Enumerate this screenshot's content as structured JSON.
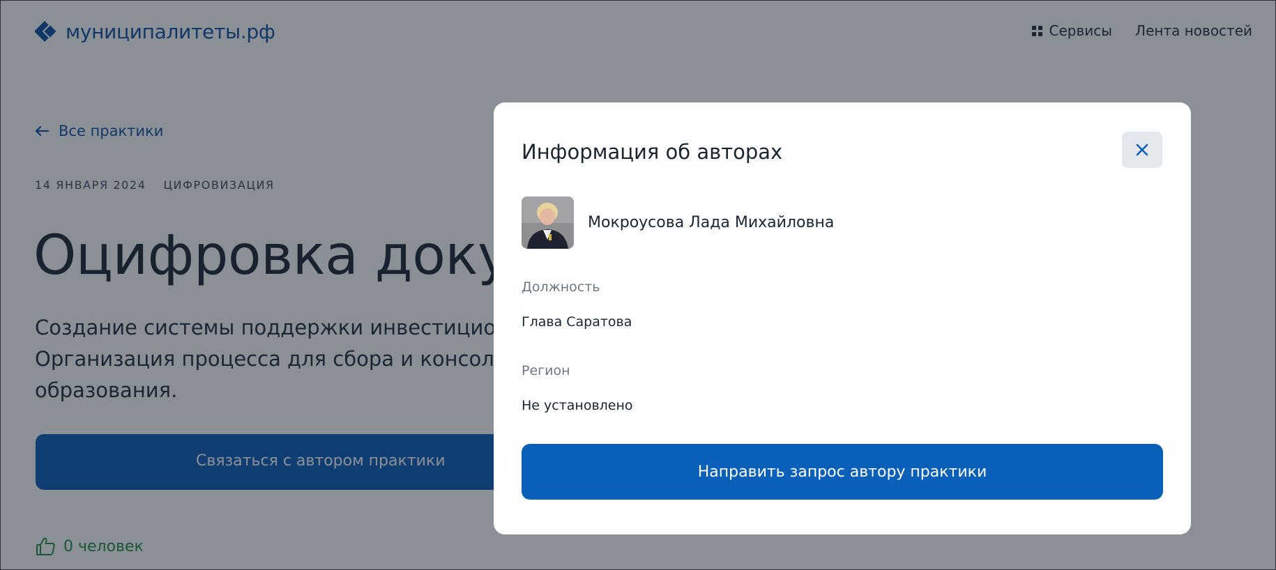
{
  "header": {
    "logo_text": "муниципалитеты.рф",
    "nav": {
      "services": "Сервисы",
      "news": "Лента новостей"
    }
  },
  "article": {
    "back_link": "Все практики",
    "date": "14 ЯНВАРЯ 2024",
    "category": "ЦИФРОВИЗАЦИЯ",
    "title": "Оцифровка докум",
    "lead_lines": [
      "Создание системы поддержки инвестиционн",
      "Организация процесса для сбора и консоли",
      "образования."
    ],
    "contact_button": "Связаться с автором практики",
    "likes": "0 человек"
  },
  "modal": {
    "title": "Информация об авторах",
    "author": {
      "name": "Мокроусова Лада Михайловна"
    },
    "position_label": "Должность",
    "position_value": "Глава Саратова",
    "region_label": "Регион",
    "region_value": "Не установлено",
    "submit_button": "Направить запрос автору практики"
  },
  "colors": {
    "brand": "#0a4d9c",
    "button": "#0a5fb8",
    "likes": "#1f8a3c",
    "overlay": "rgba(24,33,48,0.5)"
  },
  "icons": {
    "logo": "diamond-logo-icon",
    "services": "grid-icon",
    "back": "arrow-left-icon",
    "like": "thumbs-up-icon",
    "close": "close-icon"
  }
}
